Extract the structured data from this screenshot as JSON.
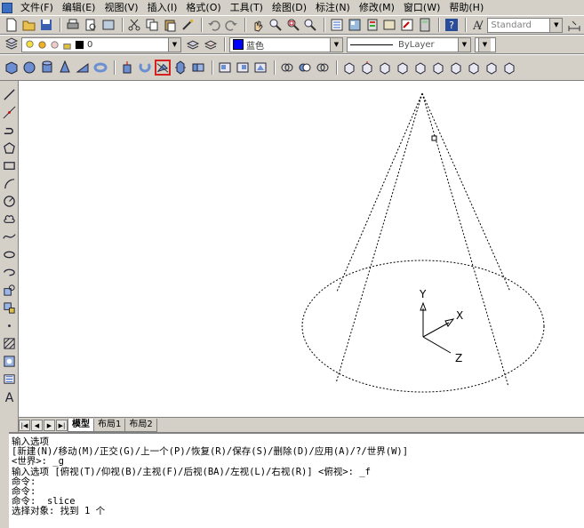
{
  "menubar": {
    "items": [
      "文件(F)",
      "编辑(E)",
      "视图(V)",
      "插入(I)",
      "格式(O)",
      "工具(T)",
      "绘图(D)",
      "标注(N)",
      "修改(M)",
      "窗口(W)",
      "帮助(H)"
    ]
  },
  "styles_toolbar": {
    "text_style": "Standard"
  },
  "layers_toolbar": {
    "layer_name": "0"
  },
  "properties_toolbar": {
    "color": "蓝色",
    "linetype": "ByLayer",
    "lineweight": "ByLayer"
  },
  "solids_toolbar": {
    "highlighted_tool": "slice-icon"
  },
  "drawing": {
    "ucs_labels": {
      "x": "X",
      "y": "Y",
      "z": "Z"
    },
    "line_color": "#000000",
    "background": "#ffffff"
  },
  "layout_tabs": [
    "模型",
    "布局1",
    "布局2"
  ],
  "command_lines": [
    "输入选项",
    "[新建(N)/移动(M)/正交(G)/上一个(P)/恢复(R)/保存(S)/删除(D)/应用(A)/?/世界(W)]",
    "<世界>: _g",
    "输入选项 [俯视(T)/仰视(B)/主视(F)/后视(BA)/左视(L)/右视(R)] <俯视>: _f",
    "命令:",
    "命令:",
    "命令: _slice",
    "选择对象: 找到 1 个"
  ],
  "colors": {
    "highlight_border": "#d62020",
    "chrome": "#d4d0c8"
  }
}
